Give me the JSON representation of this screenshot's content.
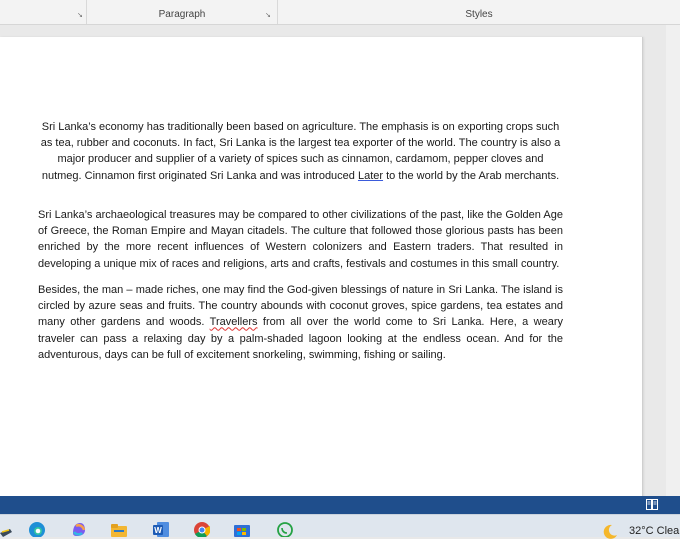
{
  "ribbon": {
    "groups": [
      {
        "label": ""
      },
      {
        "label": "Paragraph"
      },
      {
        "label": "Styles"
      }
    ]
  },
  "document": {
    "p1": "Sri Lanka’s economy has traditionally been based on agriculture. The emphasis is on exporting crops such as tea, rubber and coconuts. In fact, Sri Lanka is the largest tea exporter of the world. The country is also a major producer and supplier of a variety of spices such as cinnamon, cardamom, pepper cloves and nutmeg. Cinnamon first originated Sri Lanka and was introduced ",
    "p1_flag": "Later",
    "p1_end": " to the world by the Arab merchants.",
    "p2": "Sri Lanka’s archaeological treasures may be compared to other civilizations of the past, like the Golden Age of Greece, the Roman Empire and Mayan citadels. The culture that followed those glorious pasts has been enriched by the more recent influences of Western colonizers and Eastern traders. That resulted in developing a unique mix of races and religions, arts and crafts, festivals and costumes in this small country.",
    "p3_start": "Besides, the man – made riches, one may find the God-given blessings of nature in Sri Lanka. The island is circled by azure seas and fruits. The country abounds with coconut groves, spice gardens, tea estates and many other gardens and woods.  ",
    "p3_flag": "Travellers",
    "p3_end": " from all over the world come to Sri Lanka. Here, a weary traveler can pass a relaxing day by a palm-shaded lagoon looking at the endless ocean. And for the adventurous, days can be full of excitement snorkeling, swimming, fishing or sailing."
  },
  "taskbar": {
    "icons": [
      "start-icon",
      "edge-icon",
      "copilot-icon",
      "file-explorer-icon",
      "word-icon",
      "chrome-icon",
      "store-icon",
      "whatsapp-icon"
    ],
    "weather_temp": "32°C",
    "weather_text": "Clea"
  },
  "colors": {
    "statusbar": "#1f4e8c",
    "ribbon": "#f3f3f3",
    "spell_red": "#e03131",
    "grammar_blue": "#3b5bdb"
  }
}
